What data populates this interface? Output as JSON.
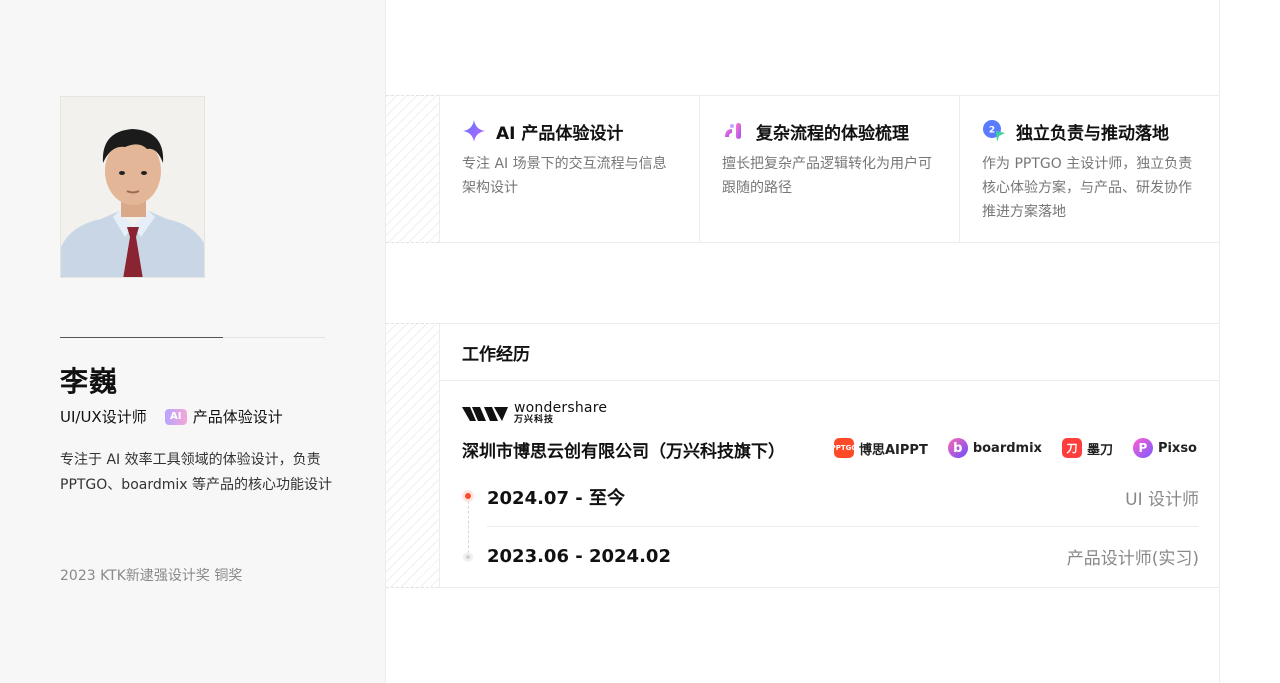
{
  "profile": {
    "name": "李巍",
    "role": "UI/UX设计师",
    "badge": "AI",
    "specialty": "产品体验设计",
    "bio": "专注于 AI 效率工具领域的体验设计，负责 PPTGO、boardmix 等产品的核心功能设计",
    "award": "2023 KTK新逮强设计奖 铜奖"
  },
  "skills": [
    {
      "icon": "sparkle-icon",
      "title": "AI 产品体验设计",
      "desc": "专注 AI 场景下的交互流程与信息架构设计"
    },
    {
      "icon": "flow-icon",
      "title": "复杂流程的体验梳理",
      "desc": "擅长把复杂产品逻辑转化为用户可跟随的路径"
    },
    {
      "icon": "chat-icon",
      "title": "独立负责与推动落地",
      "desc": "作为 PPTGO 主设计师，独立负责核心体验方案，与产品、研发协作推进方案落地"
    }
  ],
  "work": {
    "section_title": "工作经历",
    "logo_en": "wondershare",
    "logo_cn": "万兴科技",
    "company": "深圳市博思云创有限公司（万兴科技旗下）",
    "products": [
      {
        "icon_text": "PPTGO",
        "name": "博思AIPPT",
        "color": "#ff4a2a"
      },
      {
        "icon_text": "b",
        "name": "boardmix",
        "color": "#7a4dff"
      },
      {
        "icon_text": "刀",
        "name": "墨刀",
        "color": "#ff3d3d"
      },
      {
        "icon_text": "P",
        "name": "Pixso",
        "color": "#e84be0"
      }
    ],
    "jobs": [
      {
        "date": "2024.07 - 至今",
        "title": "UI 设计师"
      },
      {
        "date": "2023.06 - 2024.02",
        "title": "产品设计师(实习)"
      }
    ]
  }
}
